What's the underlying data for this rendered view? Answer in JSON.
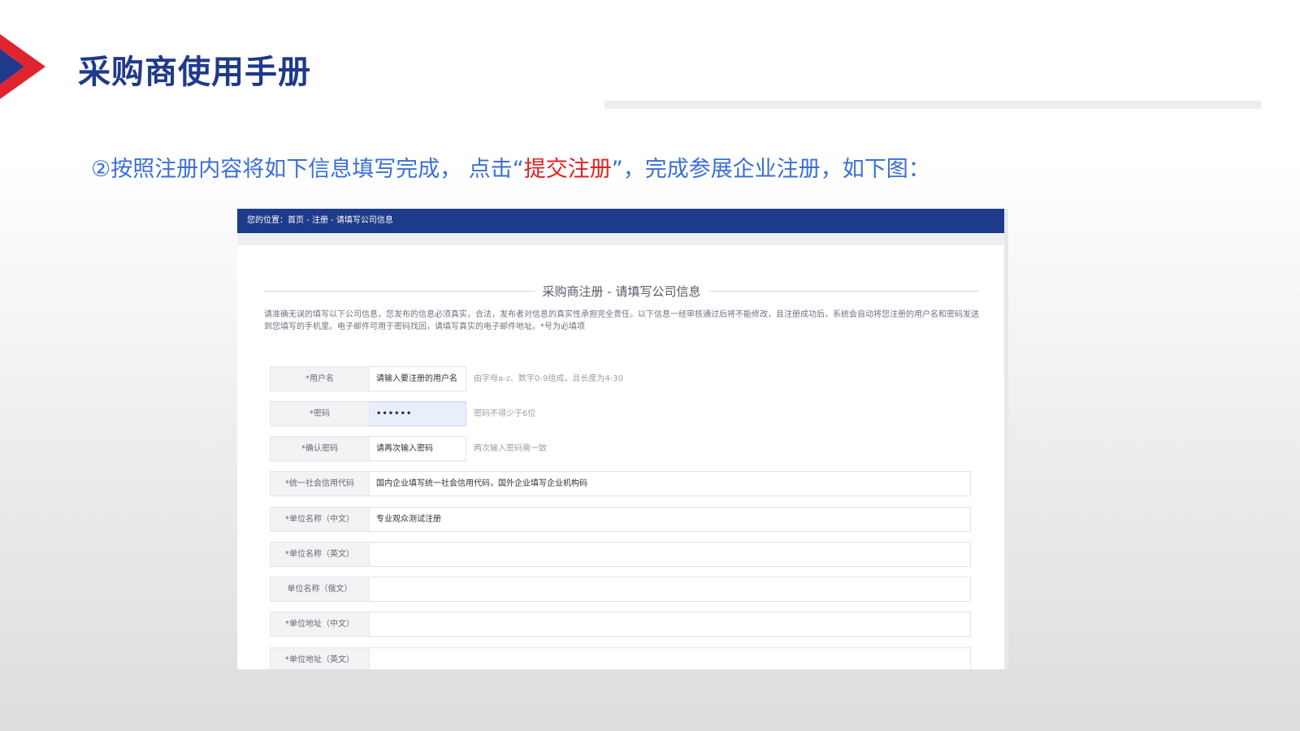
{
  "slide": {
    "title": "采购商使用手册",
    "instruction_before": "②按照注册内容将如下信息填写完成， 点击“",
    "instruction_highlight": "提交注册",
    "instruction_after": "”，完成参展企业注册，如下图："
  },
  "colors": {
    "title": "#1f3a8a",
    "instruction": "#3a6fd6",
    "highlight": "#e02020",
    "nav_bar": "#1e3a8a",
    "chevron_red": "#e0242f",
    "chevron_blue": "#1f3a8a"
  },
  "screenshot": {
    "breadcrumb": "您的位置：首页 - 注册 - 请填写公司信息",
    "form_title": "采购商注册 - 请填写公司信息",
    "notice": "请准确无误的填写以下公司信息，您发布的信息必须真实，合法，发布者对信息的真实性承担完全责任。以下信息一经审核通过后将不能修改，且注册成功后，系统会自动将您注册的用户名和密码发送到您填写的手机里。电子邮件可用于密码找回，请填写真实的电子邮件地址。*号为必填项",
    "fields": [
      {
        "label": "*用户名",
        "value": "请输入要注册的用户名",
        "hint": "由字母a-z、数字0-9组成，且长度为4-30"
      },
      {
        "label": "*密码",
        "value": "••••••",
        "hint": "密码不得少于6位"
      },
      {
        "label": "*确认密码",
        "value": "请再次输入密码",
        "hint": "两次输入密码需一致"
      },
      {
        "label": "*统一社会信用代码",
        "value": "国内企业填写统一社会信用代码，国外企业填写企业机构码"
      },
      {
        "label": "*单位名称（中文）",
        "value": "专业观众测试注册"
      },
      {
        "label": "*单位名称（英文）",
        "value": ""
      },
      {
        "label": "单位名称（俄文）",
        "value": ""
      },
      {
        "label": "*单位地址（中文）",
        "value": ""
      },
      {
        "label": "*单位地址（英文）",
        "value": ""
      }
    ]
  }
}
